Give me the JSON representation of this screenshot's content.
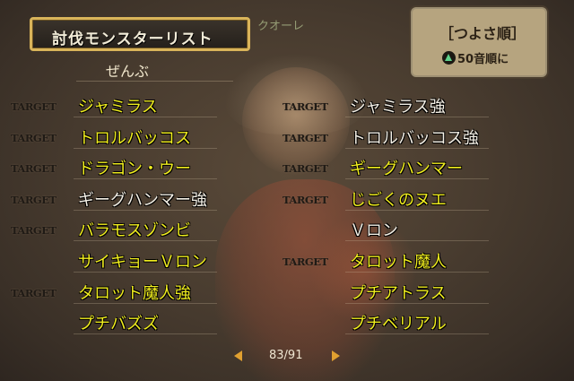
{
  "title": "討伐モンスターリスト",
  "faded_name": "クオーレ",
  "sort": {
    "label": "［つよさ順］",
    "hint_icon": "triangle-icon",
    "hint_text": "50音順に"
  },
  "category": "ぜんぶ",
  "target_tag": "TARGET",
  "left_column": [
    {
      "name": "ジャミラス",
      "target": true,
      "color": "#f1ee1f"
    },
    {
      "name": "トロルバッコス",
      "target": true,
      "color": "#f1ee1f"
    },
    {
      "name": "ドラゴン・ウー",
      "target": true,
      "color": "#f1ee1f"
    },
    {
      "name": "ギーグハンマー強",
      "target": true,
      "color": "#f4f0e6"
    },
    {
      "name": "バラモスゾンビ",
      "target": true,
      "color": "#f1ee1f"
    },
    {
      "name": "サイキョーＶロン",
      "target": false,
      "color": "#f1ee1f"
    },
    {
      "name": "タロット魔人強",
      "target": true,
      "color": "#f1ee1f"
    },
    {
      "name": "プチバズズ",
      "target": false,
      "color": "#f1ee1f"
    }
  ],
  "right_column": [
    {
      "name": "ジャミラス強",
      "target": true,
      "color": "#f4f0e6"
    },
    {
      "name": "トロルバッコス強",
      "target": true,
      "color": "#f4f0e6"
    },
    {
      "name": "ギーグハンマー",
      "target": true,
      "color": "#f1ee1f"
    },
    {
      "name": "じごくのヌエ",
      "target": true,
      "color": "#f1ee1f"
    },
    {
      "name": "Ｖロン",
      "target": false,
      "color": "#f4f0e6"
    },
    {
      "name": "タロット魔人",
      "target": true,
      "color": "#f1ee1f"
    },
    {
      "name": "プチアトラス",
      "target": false,
      "color": "#f1ee1f"
    },
    {
      "name": "プチベリアル",
      "target": false,
      "color": "#f1ee1f"
    }
  ],
  "pager": {
    "page": "83/91"
  }
}
